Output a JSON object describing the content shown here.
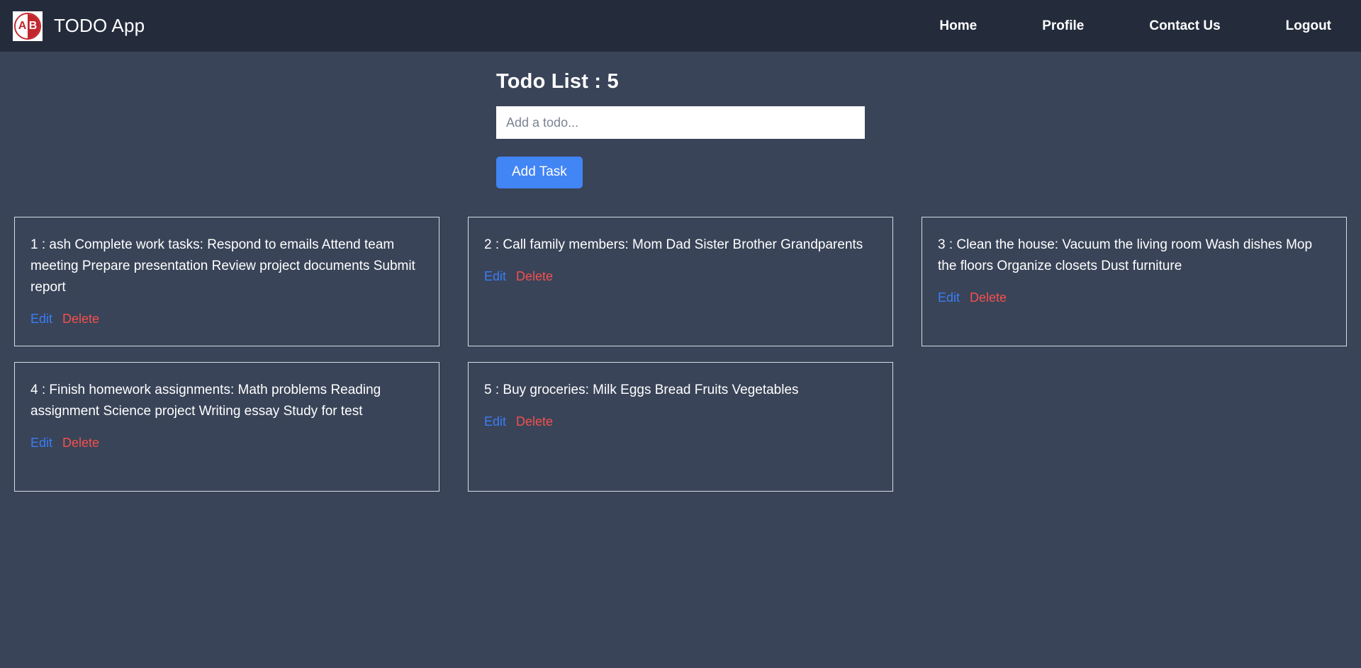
{
  "navbar": {
    "logo": {
      "icon": "ab-logo-icon",
      "left_letter": "A",
      "right_letter": "B"
    },
    "brand_title": "TODO App",
    "links": [
      {
        "label": "Home"
      },
      {
        "label": "Profile"
      },
      {
        "label": "Contact Us"
      },
      {
        "label": "Logout"
      }
    ]
  },
  "main": {
    "page_title": "Todo List : 5",
    "input": {
      "placeholder": "Add a todo...",
      "value": ""
    },
    "add_button_label": "Add Task",
    "actions": {
      "edit_label": "Edit",
      "delete_label": "Delete"
    },
    "todos": [
      {
        "text": "1 : ash Complete work tasks: Respond to emails Attend team meeting Prepare presentation Review project documents Submit report"
      },
      {
        "text": "2 : Call family members: Mom Dad Sister Brother Grandparents"
      },
      {
        "text": "3 : Clean the house: Vacuum the living room Wash dishes Mop the floors Organize closets Dust furniture"
      },
      {
        "text": "4 : Finish homework assignments: Math problems Reading assignment Science project Writing essay Study for test"
      },
      {
        "text": "5 : Buy groceries: Milk Eggs Bread Fruits Vegetables"
      }
    ]
  },
  "colors": {
    "navbar_bg": "#242c3c",
    "page_bg": "#394458",
    "accent_blue": "#4285f4",
    "edit_blue": "#3b7ef5",
    "delete_red": "#f4504e",
    "logo_red": "#c1272d",
    "card_border": "#d9dde4"
  }
}
